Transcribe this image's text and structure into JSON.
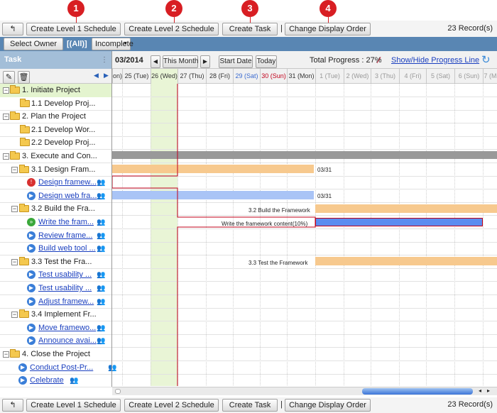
{
  "toolbar": {
    "back_icon": "back-arrow-icon",
    "create_l1": "Create Level 1 Schedule",
    "create_l2": "Create Level 2 Schedule",
    "create_task": "Create Task",
    "change_order": "Change Display Order",
    "sep": "|",
    "records": "23 Record(s)"
  },
  "callouts": [
    "1",
    "2",
    "3",
    "4"
  ],
  "filter": {
    "select_owner": "Select Owner",
    "owner_value": "[(All)]",
    "status_value": "Incomplete"
  },
  "gantt_header": {
    "task_label": "Task",
    "month": "03/2014",
    "this_month": "This Month",
    "start_date": "Start Date",
    "today": "Today",
    "total_progress": "Total Progress : 27%",
    "show_hide": "Show/Hide Progress Line"
  },
  "days": [
    "on)",
    "25 (Tue)",
    "26 (Wed)",
    "27 (Thu)",
    "28 (Fri)",
    "29 (Sat)",
    "30 (Sun)",
    "31 (Mon)",
    "1 (Tue)",
    "2 (Wed)",
    "3 (Thu)",
    "4 (Fri)",
    "5 (Sat)",
    "6 (Sun)",
    "7 (M"
  ],
  "colors": {
    "today": "#e9f5d6",
    "summary_bar": "#f7c98e",
    "task_bar": "#a9c4f6",
    "progress_bar": "#5b8cf0",
    "progress_line": "#c0001a",
    "header_blue": "#5986b3"
  },
  "tasks": [
    {
      "label": "1. Initiate Project",
      "type": "root"
    },
    {
      "label": "1.1 Develop Proj...",
      "type": "folder"
    },
    {
      "label": "2. Plan the Project",
      "type": "root"
    },
    {
      "label": "2.1 Develop Wor...",
      "type": "folder"
    },
    {
      "label": "2.2 Develop Proj...",
      "type": "folder"
    },
    {
      "label": "3. Execute and Con...",
      "type": "root"
    },
    {
      "label": "3.1 Design Fram...",
      "type": "sub"
    },
    {
      "label": "Design framew...",
      "type": "task",
      "status": "red"
    },
    {
      "label": "Design web fra...",
      "type": "task",
      "status": "blue"
    },
    {
      "label": "3.2 Build the Fra...",
      "type": "sub"
    },
    {
      "label": "Write the fram...",
      "type": "task",
      "status": "green"
    },
    {
      "label": "Review frame...",
      "type": "task",
      "status": "blue"
    },
    {
      "label": "Build web tool ...",
      "type": "task",
      "status": "blue"
    },
    {
      "label": "3.3 Test the Fra...",
      "type": "sub"
    },
    {
      "label": "Test usability ...",
      "type": "task",
      "status": "blue"
    },
    {
      "label": "Test usability ...",
      "type": "task",
      "status": "blue"
    },
    {
      "label": "Adjust framew...",
      "type": "task",
      "status": "blue"
    },
    {
      "label": "3.4 Implement Fr...",
      "type": "sub"
    },
    {
      "label": "Move framewo...",
      "type": "task",
      "status": "blue"
    },
    {
      "label": "Announce avai...",
      "type": "task",
      "status": "blue"
    },
    {
      "label": "4. Close the Project",
      "type": "root"
    },
    {
      "label": "Conduct Post-Pr...",
      "type": "task4",
      "status": "blue"
    },
    {
      "label": "Celebrate",
      "type": "task4",
      "status": "blue"
    }
  ],
  "bars": {
    "b1_end": "03/31",
    "b2_end": "03/31",
    "b3_label": "3.2 Build the Framework",
    "b4_label": "Write the framework content(10%)",
    "b5_label": "3.3 Test the Framework"
  }
}
